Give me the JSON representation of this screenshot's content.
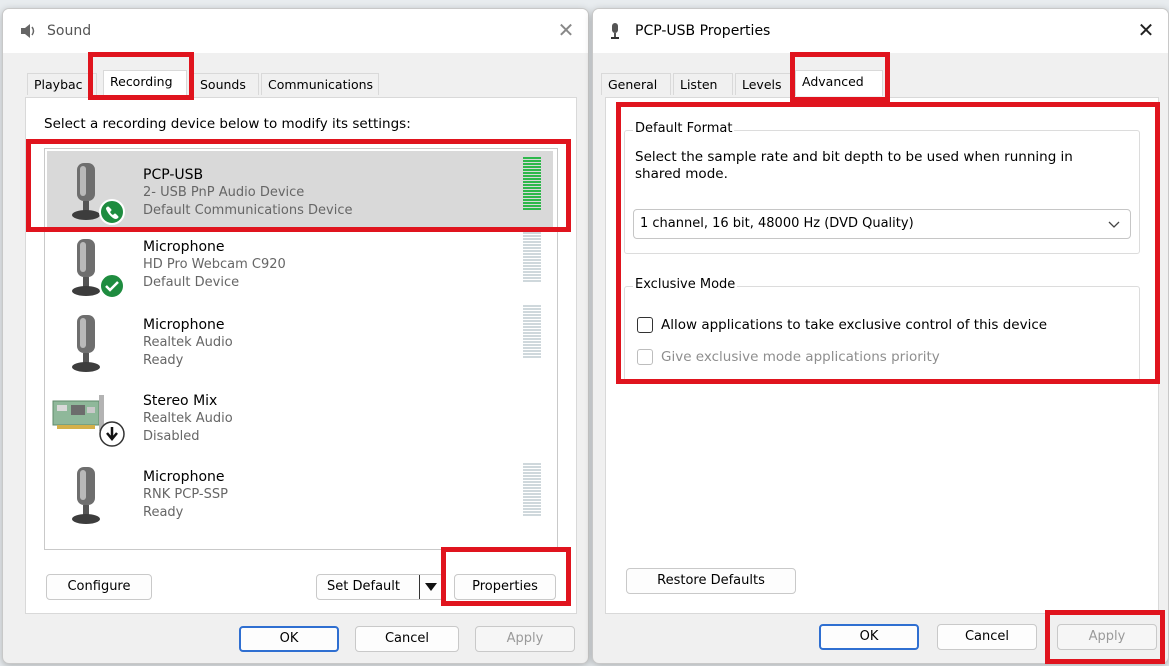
{
  "sound_window": {
    "title": "Sound",
    "tabs": [
      "Playbac",
      "Recording",
      "Sounds",
      "Communications"
    ],
    "instruction": "Select a recording device below to modify its settings:",
    "devices": [
      {
        "name": "PCP-USB",
        "line1": "2- USB PnP Audio Device",
        "line2": "Default Communications Device",
        "status_icon": "phone-badge-icon",
        "level": 1.0
      },
      {
        "name": "Microphone",
        "line1": "HD Pro Webcam C920",
        "line2": "Default Device",
        "status_icon": "check-badge-icon",
        "level": 0
      },
      {
        "name": "Microphone",
        "line1": "Realtek Audio",
        "line2": "Ready",
        "status_icon": "",
        "level": 0
      },
      {
        "name": "Stereo Mix",
        "line1": "Realtek Audio",
        "line2": "Disabled",
        "status_icon": "down-arrow-badge-icon",
        "level": null
      },
      {
        "name": "Microphone",
        "line1": "RNK PCP-SSP",
        "line2": "Ready",
        "status_icon": "",
        "level": 0
      }
    ],
    "buttons": {
      "configure": "Configure",
      "set_default": "Set Default",
      "properties": "Properties",
      "ok": "OK",
      "cancel": "Cancel",
      "apply": "Apply"
    }
  },
  "props_window": {
    "title": "PCP-USB Properties",
    "tabs": [
      "General",
      "Listen",
      "Levels",
      "Advanced"
    ],
    "default_format": {
      "label": "Default Format",
      "description": "Select the sample rate and bit depth to be used when running in shared mode.",
      "selected": "1 channel, 16 bit, 48000 Hz (DVD Quality)"
    },
    "exclusive_mode": {
      "label": "Exclusive Mode",
      "allow": "Allow applications to take exclusive control of this device",
      "allow_checked": false,
      "priority": "Give exclusive mode applications priority",
      "priority_checked": false
    },
    "buttons": {
      "restore": "Restore Defaults",
      "ok": "OK",
      "cancel": "Cancel",
      "apply": "Apply"
    }
  },
  "colors": {
    "highlight": "#e0141e",
    "level_green": "#2db84b",
    "accent": "#2f6fd1"
  }
}
